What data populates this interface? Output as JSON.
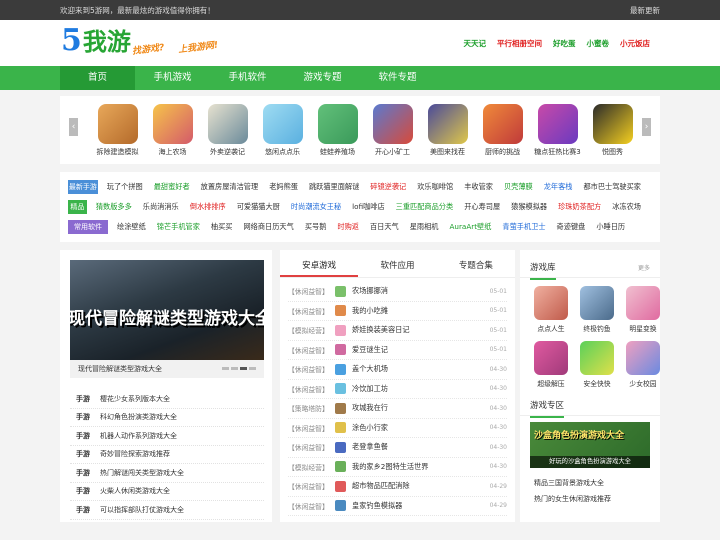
{
  "topbar": {
    "welcome": "欢迎来到5游网，最新最炫的游戏值得你拥有！",
    "latest": "最新更新"
  },
  "logo": {
    "five": "5",
    "chars": "我游",
    "slogan1": "找游戏?",
    "slogan2": "上我游网!"
  },
  "hot_links": [
    {
      "label": "天天记",
      "color": "#1b9e2a"
    },
    {
      "label": "平行相册空间",
      "color": "#e02020"
    },
    {
      "label": "好吃蛋",
      "color": "#1b9e2a"
    },
    {
      "label": "小蜜卷",
      "color": "#1b9e2a"
    },
    {
      "label": "小元饭店",
      "color": "#e02020"
    }
  ],
  "nav": [
    "首页",
    "手机游戏",
    "手机软件",
    "游戏专题",
    "软件专题"
  ],
  "carousel": [
    {
      "name": "拆除建造模拟",
      "c1": "#e8a85a",
      "c2": "#b46a2a"
    },
    {
      "name": "海上农场",
      "c1": "#f6c44a",
      "c2": "#d45a6a"
    },
    {
      "name": "外卖逆袭记",
      "c1": "#e7e2d0",
      "c2": "#6a8a9a"
    },
    {
      "name": "悠闲点点乐",
      "c1": "#9fdcf2",
      "c2": "#5ab0e0"
    },
    {
      "name": "蛙蛙养殖场",
      "c1": "#62c07a",
      "c2": "#3a9a5a"
    },
    {
      "name": "开心小矿工",
      "c1": "#5a7ad0",
      "c2": "#d84a3a"
    },
    {
      "name": "美图来找茬",
      "c1": "#4a4a9a",
      "c2": "#e0c84a"
    },
    {
      "name": "厨师的挑战",
      "c1": "#f08a3a",
      "c2": "#c03a3a"
    },
    {
      "name": "糖点狂热比赛3",
      "c1": "#c84aa8",
      "c2": "#6a3ac0"
    },
    {
      "name": "悦图秀",
      "c1": "#2a2a2a",
      "c2": "#f5d020"
    }
  ],
  "tag_rows": [
    {
      "label": "最新手游",
      "color": "#4a8fd8",
      "items": [
        {
          "t": "玩了个拼图",
          "c": "#333"
        },
        {
          "t": "最甜蜜好者",
          "c": "#1b9e2a"
        },
        {
          "t": "放置房屋清洁管理",
          "c": "#333"
        },
        {
          "t": "老妈熊蛋",
          "c": "#333"
        },
        {
          "t": "跳跃猫里面解谜",
          "c": "#333"
        },
        {
          "t": "碎镜逆袭记",
          "c": "#e02020"
        },
        {
          "t": "欢乐咖啡馆",
          "c": "#333"
        },
        {
          "t": "丰收管家",
          "c": "#333"
        },
        {
          "t": "贝壳薄膜",
          "c": "#1b9e2a"
        },
        {
          "t": "龙年客栈",
          "c": "#1f6ad8"
        },
        {
          "t": "都市巴士驾驶买家",
          "c": "#333"
        }
      ]
    },
    {
      "label": "精品手游",
      "color": "#3ab44a",
      "items": [
        {
          "t": "猜数版多多",
          "c": "#1b9e2a"
        },
        {
          "t": "乐尚消消乐",
          "c": "#333"
        },
        {
          "t": "倒水排排序",
          "c": "#e02020"
        },
        {
          "t": "可爱猫猫大厨",
          "c": "#333"
        },
        {
          "t": "时尚潮流女王秘",
          "c": "#1f6ad8"
        },
        {
          "t": "lofi咖啡店",
          "c": "#333"
        },
        {
          "t": "三重匹配商品分类",
          "c": "#1b9e2a"
        },
        {
          "t": "开心寿司屋",
          "c": "#333"
        },
        {
          "t": "猿猴模拟器",
          "c": "#333"
        },
        {
          "t": "珍珠奶茶配方",
          "c": "#e02020"
        },
        {
          "t": "冰冻农场",
          "c": "#333"
        }
      ]
    },
    {
      "label": "常用软件",
      "color": "#8a6ad0",
      "items": [
        {
          "t": "绘涂壁纸",
          "c": "#333"
        },
        {
          "t": "锦芒手机管家",
          "c": "#1b9e2a"
        },
        {
          "t": "柚买买",
          "c": "#333"
        },
        {
          "t": "网络商日历天气",
          "c": "#333"
        },
        {
          "t": "买号鹅",
          "c": "#333"
        },
        {
          "t": "时购返",
          "c": "#e02020"
        },
        {
          "t": "百日天气",
          "c": "#333"
        },
        {
          "t": "星雨相机",
          "c": "#333"
        },
        {
          "t": "AuraArt壁纸",
          "c": "#1b9e2a"
        },
        {
          "t": "青萤手机卫士",
          "c": "#1f6ad8"
        },
        {
          "t": "奇迹键盘",
          "c": "#333"
        },
        {
          "t": "小睡日历",
          "c": "#333"
        }
      ]
    }
  ],
  "banner": {
    "text": "现代冒险解谜类型游戏大全",
    "caption": "现代冒险解谜类型游戏大全"
  },
  "topic_prefix": "手游",
  "topics": [
    "樱花少女系列版本大全",
    "科幻角色扮演类游戏大全",
    "机器人动作系列游戏大全",
    "奇妙冒险探索游戏推荐",
    "热门解谜闯关类型游戏大全",
    "火柴人休闲类游戏大全",
    "可以指挥部队打仗游戏大全"
  ],
  "mid_tabs": [
    "安卓游戏",
    "软件应用",
    "专题合集"
  ],
  "news": [
    {
      "cat": "【休闲益智】",
      "title": "农场挪挪消",
      "date": "05-01",
      "c": "#7ac06a"
    },
    {
      "cat": "【休闲益智】",
      "title": "我的小吃摊",
      "date": "05-01",
      "c": "#e08a4a"
    },
    {
      "cat": "【模拟经营】",
      "title": "娇娃换装美容日记",
      "date": "05-01",
      "c": "#f0a0c0"
    },
    {
      "cat": "【休闲益智】",
      "title": "爱豆谜生记",
      "date": "05-01",
      "c": "#d06aa0"
    },
    {
      "cat": "【休闲益智】",
      "title": "盖个大机场",
      "date": "04-30",
      "c": "#4aa0e0"
    },
    {
      "cat": "【休闲益智】",
      "title": "冷饮加工坊",
      "date": "04-30",
      "c": "#6ac0e0"
    },
    {
      "cat": "【策略塔防】",
      "title": "攻城我在行",
      "date": "04-30",
      "c": "#a07a4a"
    },
    {
      "cat": "【休闲益智】",
      "title": "涂色小行家",
      "date": "04-30",
      "c": "#e0c04a"
    },
    {
      "cat": "【休闲益智】",
      "title": "老登拿鱼餐",
      "date": "04-30",
      "c": "#4a6ac0"
    },
    {
      "cat": "【模拟经营】",
      "title": "我的家乡2图特生活世界",
      "date": "04-30",
      "c": "#6ab05a"
    },
    {
      "cat": "【休闲益智】",
      "title": "超市物品匹配消除",
      "date": "04-29",
      "c": "#e05a5a"
    },
    {
      "cat": "【休闲益智】",
      "title": "皇家钓鱼模拟器",
      "date": "04-29",
      "c": "#4a8ac0"
    }
  ],
  "library": {
    "title": "游戏库",
    "more": "更多",
    "items": [
      {
        "name": "点点人生",
        "c1": "#f0b0a0",
        "c2": "#c05a4a"
      },
      {
        "name": "终极钓鱼",
        "c1": "#a0c0e0",
        "c2": "#4a6a8a"
      },
      {
        "name": "明星变换",
        "c1": "#f0c0d0",
        "c2": "#e06aa0"
      },
      {
        "name": "超级解压",
        "c1": "#e05aa0",
        "c2": "#a03a7a"
      },
      {
        "name": "安全快快",
        "c1": "#5ad05a",
        "c2": "#e0e04a"
      },
      {
        "name": "少女校园",
        "c1": "#f0a0c0",
        "c2": "#6a8ae0"
      }
    ]
  },
  "zone": {
    "title": "游戏专区",
    "img_title": "沙盒角色扮演游戏大全",
    "img_caption": "好玩的沙盒角色扮演游戏大全",
    "items": [
      "精品三国背景游戏大全",
      "热门的女生休闲游戏推荐"
    ]
  }
}
